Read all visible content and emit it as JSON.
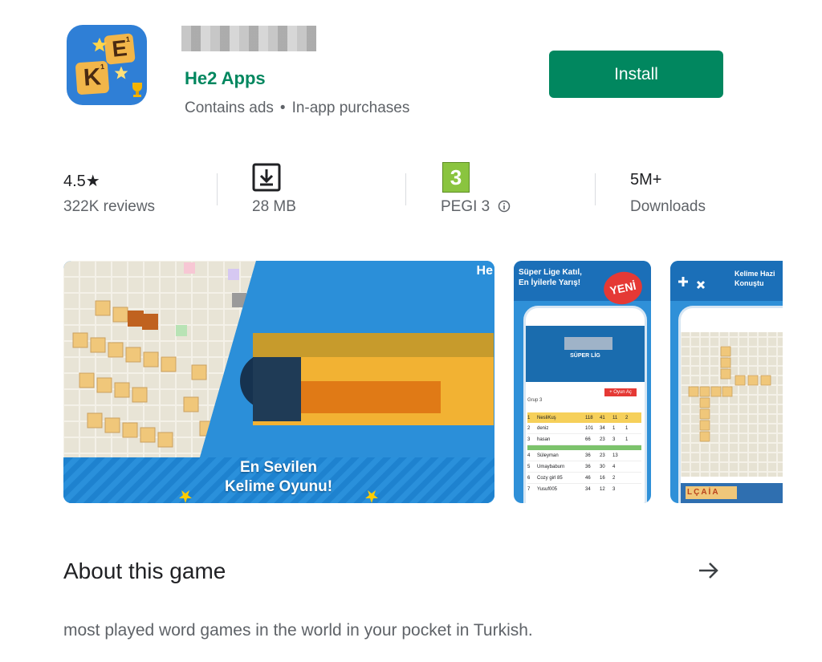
{
  "app": {
    "developer": "He2 Apps",
    "contains_ads": "Contains ads",
    "separator": "•",
    "in_app": "In-app purchases",
    "icon_letters": [
      "E",
      "K"
    ],
    "icon_subs": [
      "1",
      "1"
    ]
  },
  "install": {
    "label": "Install"
  },
  "stats": {
    "rating": {
      "value": "4.5★",
      "label": "322K reviews"
    },
    "size": {
      "label": "28 MB",
      "icon": "download-icon"
    },
    "pegi": {
      "badge": "3",
      "label": "PEGI 3",
      "icon": "info-icon"
    },
    "downloads": {
      "value": "5M+",
      "label": "Downloads"
    }
  },
  "screenshots": {
    "main": {
      "line1": "En Sevilen",
      "line2": "Kelime Oyunu!",
      "corner": "He"
    },
    "second": {
      "banner1": "Süper Lige Katıl,",
      "banner2": "En İyilerle Yarış!",
      "badge": "YENİ",
      "screen_title": "SÜPER LİG",
      "group": "Grup 3",
      "button": "+ Oyun Aç",
      "rows": [
        {
          "n": "1",
          "name": "NesliKuş",
          "v": [
            "118",
            "41",
            "11",
            "2"
          ]
        },
        {
          "n": "2",
          "name": "deniz",
          "v": [
            "101",
            "34",
            "1",
            "1"
          ]
        },
        {
          "n": "3",
          "name": "hasan",
          "v": [
            "66",
            "23",
            "3",
            "1"
          ]
        },
        {
          "n": "4",
          "name": "Süleyman",
          "v": [
            "36",
            "23",
            "13",
            ""
          ]
        },
        {
          "n": "5",
          "name": "Umaybaburn",
          "v": [
            "36",
            "30",
            "4",
            ""
          ]
        },
        {
          "n": "6",
          "name": "Cozy girl 85",
          "v": [
            "46",
            "16",
            "2",
            ""
          ]
        },
        {
          "n": "7",
          "name": "Yusuf005",
          "v": [
            "34",
            "12",
            "3",
            ""
          ]
        }
      ]
    },
    "third": {
      "banner1": "Kelime Hazi",
      "banner2": "Konuştu",
      "word": "LÇAİA"
    }
  },
  "about": {
    "title": "About this game",
    "arrow_icon": "arrow-right-icon"
  },
  "description": "most played word games in the world in your pocket in Turkish.",
  "colors": {
    "accent": "#01875f",
    "pegi_green": "#8ac43f"
  }
}
